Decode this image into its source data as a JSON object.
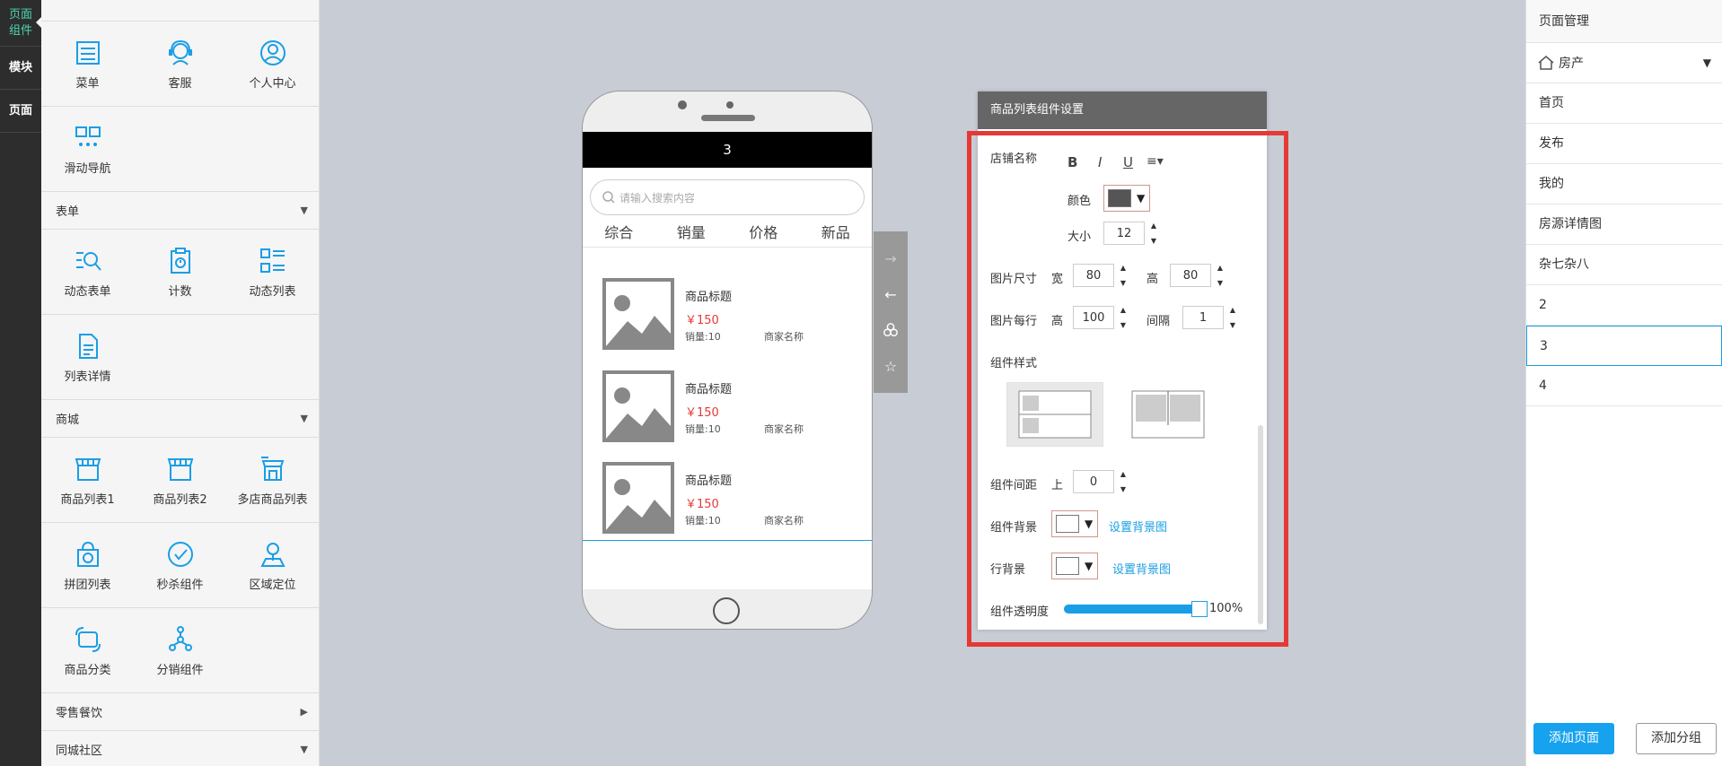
{
  "rail": {
    "items": [
      {
        "label_line1": "页面",
        "label_line2": "组件"
      },
      {
        "label": "模块"
      },
      {
        "label": "页面"
      }
    ]
  },
  "library": {
    "row1": [
      {
        "label": "菜单",
        "icon": "menu-icon"
      },
      {
        "label": "客服",
        "icon": "customer-service-icon"
      },
      {
        "label": "个人中心",
        "icon": "user-center-icon"
      }
    ],
    "row2": [
      {
        "label": "滑动导航",
        "icon": "slide-nav-icon"
      }
    ],
    "section_form": "表单",
    "row3": [
      {
        "label": "动态表单",
        "icon": "dynamic-form-icon"
      },
      {
        "label": "计数",
        "icon": "counter-icon"
      },
      {
        "label": "动态列表",
        "icon": "dynamic-list-icon"
      }
    ],
    "row4": [
      {
        "label": "列表详情",
        "icon": "list-detail-icon"
      }
    ],
    "section_mall": "商城",
    "row5": [
      {
        "label": "商品列表1",
        "icon": "shop-list-icon"
      },
      {
        "label": "商品列表2",
        "icon": "shop-list-icon"
      },
      {
        "label": "多店商品列表",
        "icon": "multi-shop-icon"
      }
    ],
    "row6": [
      {
        "label": "拼团列表",
        "icon": "group-buy-icon"
      },
      {
        "label": "秒杀组件",
        "icon": "flash-sale-icon"
      },
      {
        "label": "区域定位",
        "icon": "location-icon"
      }
    ],
    "row7": [
      {
        "label": "商品分类",
        "icon": "category-icon"
      },
      {
        "label": "分销组件",
        "icon": "distribution-icon"
      }
    ],
    "section_catering": "零售餐饮",
    "section_community": "同城社区"
  },
  "phone": {
    "title": "3",
    "search_placeholder": "请输入搜索内容",
    "tabs": [
      "综合",
      "销量",
      "价格",
      "新品"
    ],
    "products": [
      {
        "title": "商品标题",
        "price": "￥150",
        "sales": "销量:10",
        "shop": "商家名称"
      },
      {
        "title": "商品标题",
        "price": "￥150",
        "sales": "销量:10",
        "shop": "商家名称"
      },
      {
        "title": "商品标题",
        "price": "￥150",
        "sales": "销量:10",
        "shop": "商家名称"
      }
    ]
  },
  "settings": {
    "title": "商品列表组件设置",
    "shop_name_label": "店铺名称",
    "format_buttons": [
      "B",
      "I",
      "U",
      "≡▾"
    ],
    "color_label": "颜色",
    "size_label": "大小",
    "size_value": "12",
    "image_size_label": "图片尺寸",
    "width_label": "宽",
    "width_value": "80",
    "height_label": "高",
    "height_value": "80",
    "image_row_label": "图片每行",
    "row_height_label": "高",
    "row_height_value": "100",
    "gap_label": "间隔",
    "gap_value": "1",
    "style_label": "组件样式",
    "spacing_label": "组件间距",
    "spacing_top_label": "上",
    "spacing_value": "0",
    "bg_label": "组件背景",
    "bg_link": "设置背景图",
    "row_bg_label": "行背景",
    "row_bg_link": "设置背景图",
    "opacity_label": "组件透明度",
    "opacity_value": "100%",
    "opacity_fraction": 1.0,
    "text_color": "#555555"
  },
  "page_manager": {
    "title": "页面管理",
    "selected_group": "房产",
    "items": [
      "首页",
      "发布",
      "我的",
      "房源详情图",
      "杂七杂八",
      "2",
      "3",
      "4"
    ],
    "selected_index": 6,
    "add_page": "添加页面",
    "add_group": "添加分组"
  },
  "colors": {
    "accent": "#16a2ee",
    "highlight": "#e53935",
    "rail_active": "#4ad6b0"
  }
}
